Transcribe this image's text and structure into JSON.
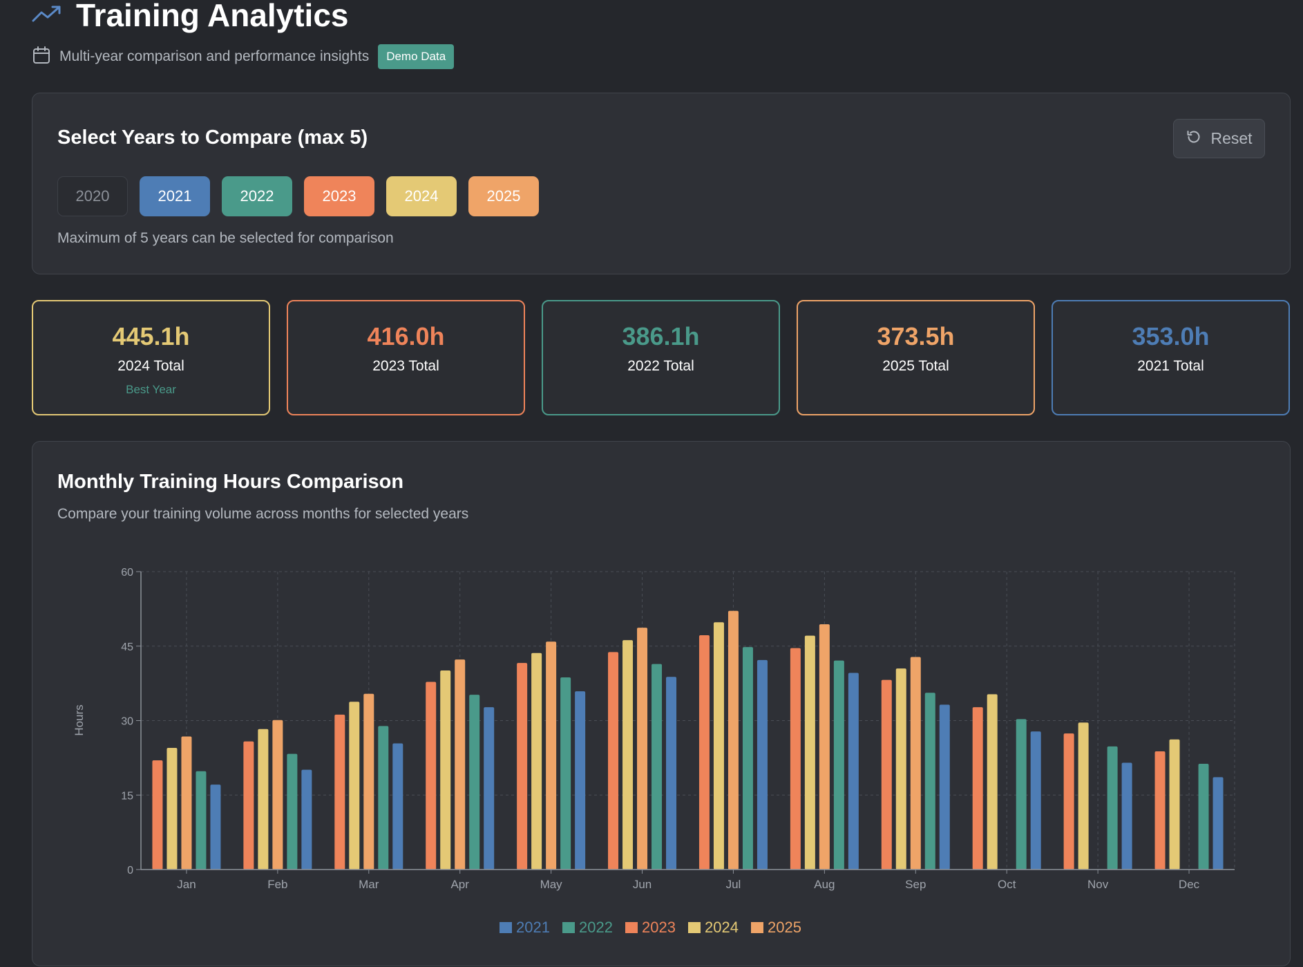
{
  "header": {
    "title": "Training Analytics",
    "subtitle": "Multi-year comparison and performance insights",
    "badge": "Demo Data",
    "title_icon": "trending-up-icon",
    "subtitle_icon": "calendar-icon"
  },
  "year_select": {
    "title": "Select Years to Compare (max 5)",
    "reset_label": "Reset",
    "reset_icon": "reset-icon",
    "hint": "Maximum of 5 years can be selected for comparison",
    "years": [
      {
        "label": "2020",
        "selected": false,
        "color": "#2a2c31"
      },
      {
        "label": "2021",
        "selected": true,
        "color": "#4e7db5"
      },
      {
        "label": "2022",
        "selected": true,
        "color": "#4a9a8a"
      },
      {
        "label": "2023",
        "selected": true,
        "color": "#ef845a"
      },
      {
        "label": "2024",
        "selected": true,
        "color": "#e4c975"
      },
      {
        "label": "2025",
        "selected": true,
        "color": "#efa468"
      }
    ]
  },
  "totals": [
    {
      "value": "445.1h",
      "label": "2024 Total",
      "note": "Best Year",
      "color": "#e4c975"
    },
    {
      "value": "416.0h",
      "label": "2023 Total",
      "note": "",
      "color": "#ef845a"
    },
    {
      "value": "386.1h",
      "label": "2022 Total",
      "note": "",
      "color": "#4a9a8a"
    },
    {
      "value": "373.5h",
      "label": "2025 Total",
      "note": "",
      "color": "#efa468"
    },
    {
      "value": "353.0h",
      "label": "2021 Total",
      "note": "",
      "color": "#4e7db5"
    }
  ],
  "chart_panel": {
    "title": "Monthly Training Hours Comparison",
    "subtitle": "Compare your training volume across months for selected years"
  },
  "chart_data": {
    "type": "bar",
    "categories": [
      "Jan",
      "Feb",
      "Mar",
      "Apr",
      "May",
      "Jun",
      "Jul",
      "Aug",
      "Sep",
      "Oct",
      "Nov",
      "Dec"
    ],
    "ylabel": "Hours",
    "ylim": [
      0,
      60
    ],
    "yticks": [
      0,
      15,
      30,
      45,
      60
    ],
    "grid": true,
    "legend_position": "bottom",
    "series": [
      {
        "name": "2023",
        "color": "#ef845a",
        "values": [
          22,
          25.8,
          31.2,
          37.8,
          41.6,
          43.8,
          47.2,
          44.6,
          38.2,
          32.7,
          27.4,
          23.8
        ]
      },
      {
        "name": "2024",
        "color": "#e4c975",
        "values": [
          24.5,
          28.3,
          33.8,
          40.1,
          43.6,
          46.2,
          49.8,
          47.1,
          40.5,
          35.3,
          29.6,
          26.2
        ]
      },
      {
        "name": "2025",
        "color": "#efa468",
        "values": [
          26.8,
          30.1,
          35.4,
          42.3,
          45.9,
          48.7,
          52.1,
          49.4,
          42.8,
          null,
          null,
          null
        ]
      },
      {
        "name": "2022",
        "color": "#4a9a8a",
        "values": [
          19.8,
          23.3,
          28.9,
          35.2,
          38.7,
          41.4,
          44.8,
          42.1,
          35.6,
          30.3,
          24.8,
          21.3
        ]
      },
      {
        "name": "2021",
        "color": "#4e7db5",
        "values": [
          17.1,
          20.1,
          25.4,
          32.7,
          35.9,
          38.8,
          42.2,
          39.6,
          33.2,
          27.8,
          21.5,
          18.6
        ]
      }
    ],
    "legend_order": [
      "2021",
      "2022",
      "2023",
      "2024",
      "2025"
    ]
  }
}
